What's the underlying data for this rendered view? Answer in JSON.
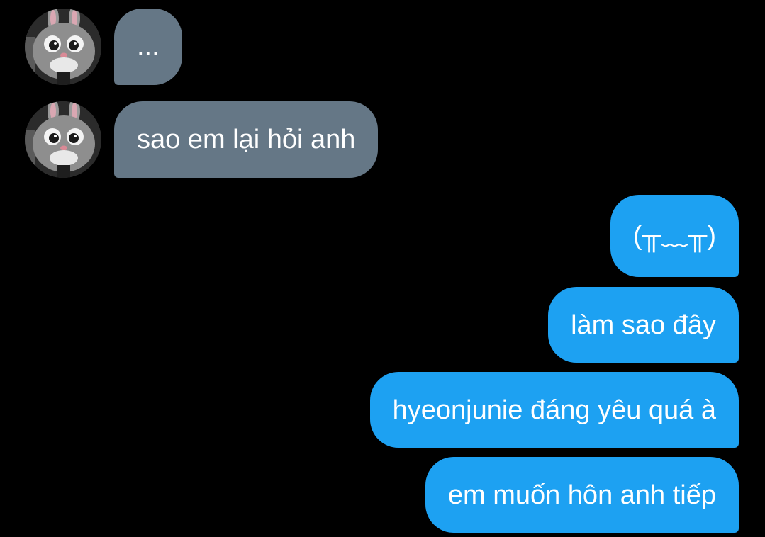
{
  "colors": {
    "background": "#000000",
    "incoming_bubble": "#657786",
    "outgoing_bubble": "#1DA1F2",
    "text": "#FFFFFF"
  },
  "conversation": {
    "incoming": [
      {
        "text": "...",
        "avatar": "bunny-mascot-avatar"
      },
      {
        "text": "sao em lại hỏi anh",
        "avatar": "bunny-mascot-avatar"
      }
    ],
    "outgoing": [
      {
        "text": "(╥﹏╥)"
      },
      {
        "text": "làm sao đây"
      },
      {
        "text": "hyeonjunie đáng yêu quá à"
      },
      {
        "text": "em muốn hôn anh tiếp"
      }
    ]
  }
}
